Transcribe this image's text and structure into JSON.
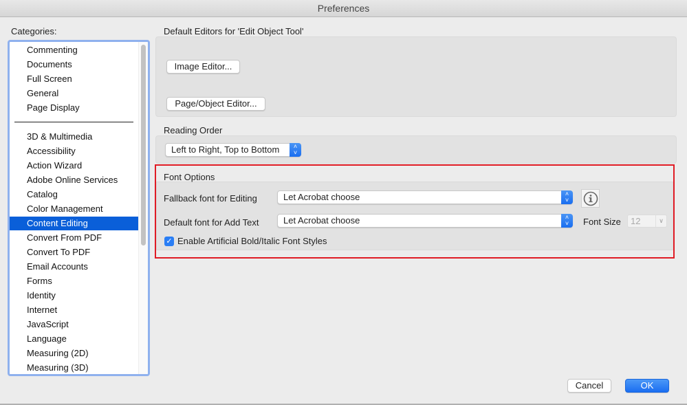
{
  "window": {
    "title": "Preferences"
  },
  "sidebar": {
    "label": "Categories:",
    "group1": [
      "Commenting",
      "Documents",
      "Full Screen",
      "General",
      "Page Display"
    ],
    "group2": [
      "3D & Multimedia",
      "Accessibility",
      "Action Wizard",
      "Adobe Online Services",
      "Catalog",
      "Color Management",
      "Content Editing",
      "Convert From PDF",
      "Convert To PDF",
      "Email Accounts",
      "Forms",
      "Identity",
      "Internet",
      "JavaScript",
      "Language",
      "Measuring (2D)",
      "Measuring (3D)"
    ],
    "selected": "Content Editing"
  },
  "editors": {
    "label": "Default Editors for 'Edit Object Tool'",
    "image_editor_button": "Image Editor...",
    "page_object_editor_button": "Page/Object Editor..."
  },
  "reading_order": {
    "label": "Reading Order",
    "value": "Left to Right, Top to Bottom"
  },
  "font_options": {
    "label": "Font Options",
    "fallback_label": "Fallback font for Editing",
    "fallback_value": "Let Acrobat choose",
    "default_label": "Default font for Add Text",
    "default_value": "Let Acrobat choose",
    "font_size_label": "Font Size",
    "font_size_value": "12",
    "artificial_styles_label": "Enable Artificial Bold/Italic Font Styles",
    "artificial_styles_checked": true,
    "highlight_color": "#e01b24"
  },
  "footer": {
    "cancel": "Cancel",
    "ok": "OK"
  },
  "colors": {
    "accent": "#0a5fd9",
    "list_focus_ring": "#8fb1ee"
  }
}
